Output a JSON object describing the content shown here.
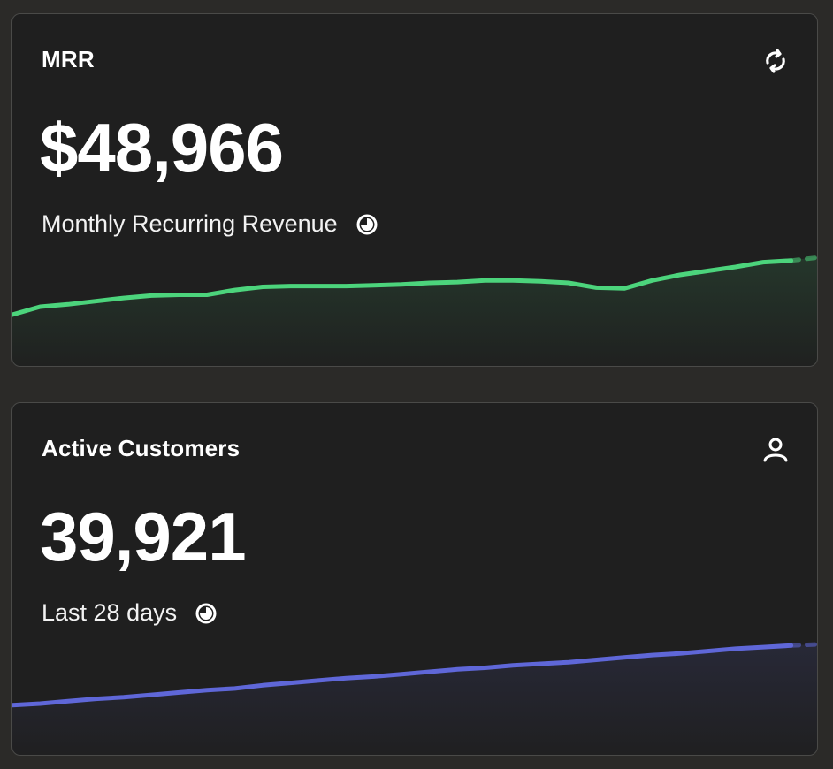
{
  "cards": [
    {
      "title": "MRR",
      "icon": "sync-icon",
      "value": "$48,966",
      "subtitle": "Monthly Recurring Revenue",
      "subtitle_icon": "clock-icon",
      "accent": "#4cd47c"
    },
    {
      "title": "Active Customers",
      "icon": "user-icon",
      "value": "39,921",
      "subtitle": "Last 28 days",
      "subtitle_icon": "clock-icon",
      "accent": "#5f67d8"
    }
  ],
  "chart_data": [
    {
      "type": "area",
      "series": [
        {
          "values": [
            0.2,
            0.3,
            0.33,
            0.37,
            0.41,
            0.44,
            0.45,
            0.45,
            0.51,
            0.55,
            0.56,
            0.56,
            0.56,
            0.57,
            0.58,
            0.6,
            0.61,
            0.63,
            0.63,
            0.62,
            0.6,
            0.54,
            0.53,
            0.63,
            0.7,
            0.75,
            0.8,
            0.86,
            0.88,
            0.93
          ],
          "projected_last": true
        }
      ]
    },
    {
      "type": "area",
      "series": [
        {
          "values": [
            0.18,
            0.2,
            0.23,
            0.26,
            0.28,
            0.31,
            0.34,
            0.37,
            0.39,
            0.43,
            0.46,
            0.49,
            0.52,
            0.54,
            0.57,
            0.6,
            0.63,
            0.65,
            0.68,
            0.7,
            0.72,
            0.75,
            0.78,
            0.81,
            0.83,
            0.86,
            0.89,
            0.91,
            0.93,
            0.95
          ],
          "projected_last": true
        }
      ]
    }
  ]
}
